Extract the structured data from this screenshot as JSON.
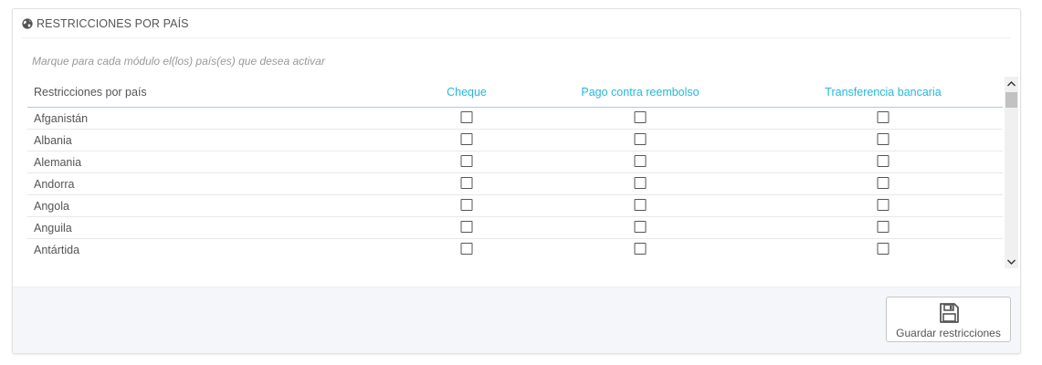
{
  "panel": {
    "title": "RESTRICCIONES POR PAÍS",
    "title_icon": "globe-icon",
    "help_text": "Marque para cada módulo el(los) país(es) que desea activar"
  },
  "table": {
    "header_first": "Restricciones por país",
    "columns": [
      "Cheque",
      "Pago contra reembolso",
      "Transferencia bancaria"
    ],
    "rows": [
      {
        "country": "Afganistán",
        "checked": [
          false,
          false,
          false
        ]
      },
      {
        "country": "Albania",
        "checked": [
          false,
          false,
          false
        ]
      },
      {
        "country": "Alemania",
        "checked": [
          false,
          false,
          false
        ]
      },
      {
        "country": "Andorra",
        "checked": [
          false,
          false,
          false
        ]
      },
      {
        "country": "Angola",
        "checked": [
          false,
          false,
          false
        ]
      },
      {
        "country": "Anguila",
        "checked": [
          false,
          false,
          false
        ]
      },
      {
        "country": "Antártida",
        "checked": [
          false,
          false,
          false
        ]
      }
    ]
  },
  "footer": {
    "save_label": "Guardar restricciones",
    "save_icon": "floppy-disk-icon"
  },
  "colors": {
    "accent": "#25b9d7",
    "text": "#555555",
    "muted": "#999999",
    "footer_bg": "#f4f6fa"
  }
}
